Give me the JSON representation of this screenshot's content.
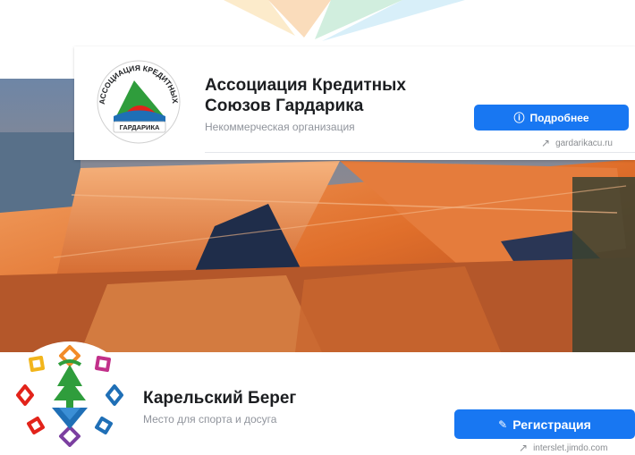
{
  "org_card": {
    "logo": {
      "arc_text": "АССОЦИАЦИЯ КРЕДИТНЫХ СОЮЗОВ",
      "banner_text": "ГАРДАРИКА"
    },
    "title": "Ассоциация Кредитных Союзов Гардарика",
    "subtitle": "Некоммерческая организация",
    "more_button": {
      "icon": "info-icon",
      "label": "Подробнее"
    },
    "website": {
      "icon": "external-link-icon",
      "text": "gardarikacu.ru"
    }
  },
  "cover": {
    "description_icon": "tent-cover-photo"
  },
  "page": {
    "title": "Карельский Берег",
    "subtitle": "Место для спорта и досуга",
    "register_button": {
      "icon": "pencil-icon",
      "label": "Регистрация"
    },
    "website": {
      "icon": "external-link-icon",
      "text": "interslet.jimdo.com"
    }
  },
  "colors": {
    "button_blue": "#1877f2",
    "text_dark": "#1c1e21",
    "text_muted": "#90949c",
    "cover_orange": "#e8782a",
    "logo_green": "#2f9d3c",
    "logo_red": "#e2231a",
    "logo_blue": "#1f6fb6"
  }
}
